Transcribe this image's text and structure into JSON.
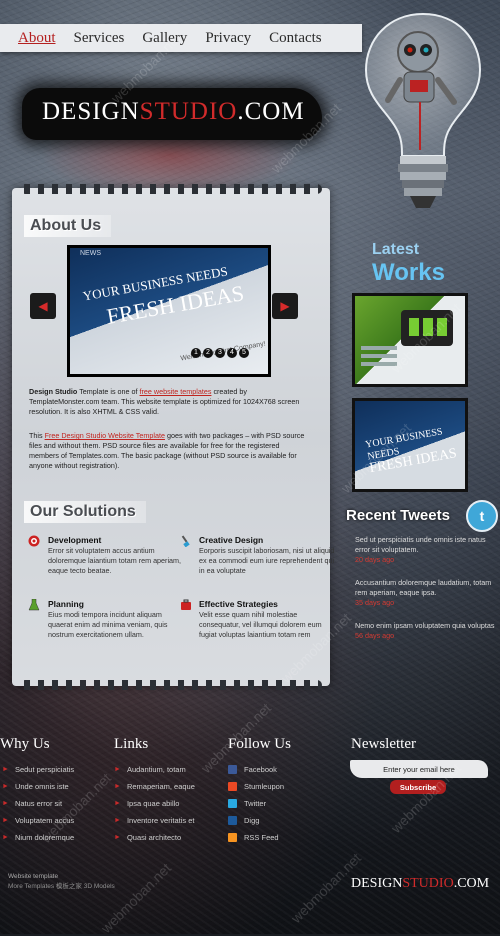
{
  "nav": {
    "items": [
      "About",
      "Services",
      "Gallery",
      "Privacy",
      "Contacts"
    ],
    "active": "About"
  },
  "logo": {
    "part1": "DESIGN",
    "part2": "STUDIO",
    "part3": ".COM"
  },
  "about": {
    "heading": "About Us",
    "slide": {
      "small": "NEWS",
      "line1": "YOUR BUSINESS NEEDS",
      "line2": "FRESH IDEAS",
      "sub": "Welcome to First Company!"
    },
    "dots": [
      "1",
      "2",
      "3",
      "4",
      "5"
    ],
    "p1": {
      "bold": "Design Studio",
      "a": " Template is one of ",
      "link": "free website templates",
      "b": " created by TemplateMonster.com team. This website template is optimized for 1024X768 screen resolution. It is also XHTML & CSS valid."
    },
    "p2": {
      "a": "This ",
      "link": "Free Design Studio Website Template",
      "b": " goes with two packages – with PSD source files and without them. PSD source files are available for free for the registered members of Templates.com. The basic package (without PSD source is available for anyone without registration)."
    }
  },
  "solutions": {
    "heading": "Our Solutions",
    "items": [
      {
        "title": "Development",
        "text": "Error sit voluptatem accus antium doloremque laiantium totam rem aperiam, eaque tecto beatae."
      },
      {
        "title": "Creative Design",
        "text": "Eorporis suscipit laboriosam, nisi ut aliquid ex ea commodi eum iure reprehendent qui in ea voluptate"
      },
      {
        "title": "Planning",
        "text": "Eius modi tempora incidunt aliquam quaerat enim ad minima veniam, quis nostrum exercitationem ullam."
      },
      {
        "title": "Effective Strategies",
        "text": "Velit esse quam nihil molestiae consequatur, vel illumqui dolorem eum fugiat voluptas laiantium totam rem"
      }
    ]
  },
  "latest_works": {
    "line1": "Latest",
    "line2": "Works",
    "work2_line1": "YOUR BUSINESS NEEDS",
    "work2_line2": "FRESH IDEAS"
  },
  "tweets": {
    "heading": "Recent Tweets",
    "items": [
      {
        "text": "Sed ut perspiciatis unde omnis iste natus error sit voluptatem.",
        "ago": "20 days ago"
      },
      {
        "text": "Accusantium doloremque laudatium, totam rem aperiam, eaque ipsa.",
        "ago": "35 days ago"
      },
      {
        "text": "Nemo enim ipsam voluptatem quia voluptas",
        "ago": "56 days ago"
      }
    ]
  },
  "footer": {
    "why": {
      "heading": "Why Us",
      "items": [
        "Sedut perspiciatis",
        "Unde omnis iste",
        "Natus error sit",
        "Voluptatem accus",
        "Nium doloremque"
      ]
    },
    "links": {
      "heading": "Links",
      "items": [
        "Audantium, totam",
        "Remaperiam, eaque",
        "Ipsa quae abillo",
        "Inventore veritatis et",
        "Quasi architecto"
      ]
    },
    "follow": {
      "heading": "Follow Us",
      "items": [
        "Facebook",
        "Stumleupon",
        "Twitter",
        "Digg",
        "RSS Feed"
      ],
      "icon_colors": [
        "#3b5998",
        "#eb4924",
        "#29a9e1",
        "#1d5a9b",
        "#f79421"
      ]
    },
    "newsletter": {
      "heading": "Newsletter",
      "placeholder": "Enter your email here",
      "button": "Subscribe"
    },
    "copyright": {
      "line1": "Website template",
      "line2": "More Templates 模板之家 3D Models"
    },
    "logo": {
      "part1": "DESIGN",
      "part2": "STUDIO",
      "part3": ".COM"
    }
  },
  "watermark": "webmoban.net",
  "colors": {
    "accent_red": "#d12b2b",
    "twitter_blue": "#3fa7d8",
    "latest_blue": "#67c4f2"
  }
}
